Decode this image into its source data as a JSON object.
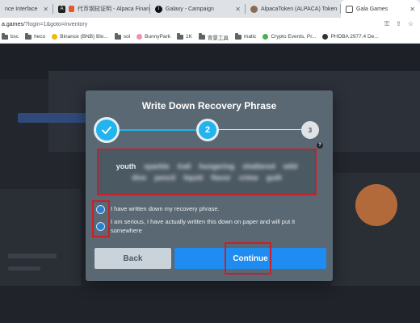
{
  "tabs": [
    {
      "label": "nce Interface",
      "favicon": "page-icon"
    },
    {
      "label": "代币钢挝证明 - Alpaca Finan",
      "favicon": "alpaca-finance-icon"
    },
    {
      "label": "Galaxy - Campaign",
      "favicon": "galaxy-icon"
    },
    {
      "label": "AlpacaToken (ALPACA) Token",
      "favicon": "alpaca-token-icon"
    },
    {
      "label": "Gala Games",
      "favicon": "gala-games-icon",
      "active": true
    }
  ],
  "address": {
    "host": "a.games",
    "path": "/?login=1&goto=inventory"
  },
  "bookmarks": [
    {
      "label": "bsc",
      "type": "folder"
    },
    {
      "label": "heco",
      "type": "folder"
    },
    {
      "label": "Binance (BNB) Blo...",
      "type": "site"
    },
    {
      "label": "sol",
      "type": "folder"
    },
    {
      "label": "BunnyPark",
      "type": "site"
    },
    {
      "label": "1K",
      "type": "folder"
    },
    {
      "label": "背景工具",
      "type": "folder"
    },
    {
      "label": "matic",
      "type": "folder"
    },
    {
      "label": "Crypto Events, Pr...",
      "type": "site"
    },
    {
      "label": "PHDBA 2977.4 De...",
      "type": "site"
    }
  ],
  "modal": {
    "title": "Write Down Recovery Phrase",
    "steps": [
      {
        "label": "✓",
        "state": "done"
      },
      {
        "label": "2",
        "state": "current"
      },
      {
        "label": "3",
        "state": "upcoming"
      }
    ],
    "help": "?",
    "phrase_words": [
      "youth",
      "sparkle",
      "trail",
      "hungering",
      "shattered",
      "wild",
      "dive",
      "pencil",
      "liquid",
      "flavor",
      "crime",
      "guilt"
    ],
    "checkbox_1": "I have written down my recovery phrase.",
    "checkbox_2": "I am serious, I have actually written this down on paper and will put it somewhere",
    "back_label": "Back",
    "continue_label": "Continue"
  },
  "colors": {
    "modal_bg": "#596873",
    "accent": "#1e8cf0",
    "highlight": "#c8202b"
  }
}
